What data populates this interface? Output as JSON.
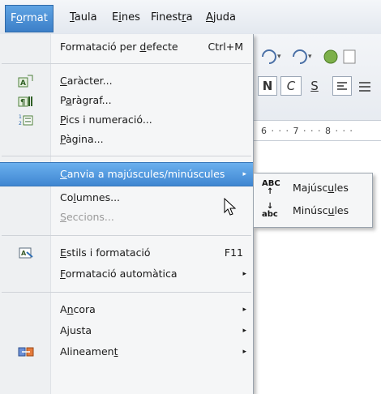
{
  "menubar": {
    "items": [
      {
        "label": "Format",
        "underline": "o",
        "active": true
      },
      {
        "label": "Taula",
        "underline": "T"
      },
      {
        "label": "Eines",
        "underline": "i"
      },
      {
        "label": "Finestra",
        "underline": "r"
      },
      {
        "label": "Ajuda",
        "underline": "A"
      }
    ]
  },
  "format_menu": {
    "default_formatting": {
      "label": "Formatació per defecte",
      "shortcut": "Ctrl+M"
    },
    "character": {
      "label": "Caràcter...",
      "icon": "character-icon"
    },
    "paragraph": {
      "label": "Paràgraf...",
      "icon": "paragraph-icon"
    },
    "bullets": {
      "label": "Pics i numeració...",
      "icon": "bullets-numbering-icon"
    },
    "page": {
      "label": "Pàgina..."
    },
    "change_case": {
      "label": "Canvia a majúscules/minúscules",
      "highlighted": true
    },
    "columns": {
      "label": "Columnes..."
    },
    "sections": {
      "label": "Seccions...",
      "disabled": true
    },
    "styles": {
      "label": "Estils i formatació",
      "shortcut": "F11",
      "icon": "styles-formatting-icon"
    },
    "autocorrect": {
      "label": "Formatació automàtica"
    },
    "anchor": {
      "label": "Àncora"
    },
    "wrap": {
      "label": "Ajusta"
    },
    "alignment": {
      "label": "Alineament",
      "icon": "alignment-icon"
    }
  },
  "change_case_submenu": {
    "uppercase": {
      "label": "Majúscules",
      "glyph_top": "ABC",
      "glyph_bottom": "↑"
    },
    "lowercase": {
      "label": "Minúscules",
      "glyph_top": "↓",
      "glyph_bottom": "abc"
    }
  },
  "toolbar": {
    "bold": "N",
    "italic": "C",
    "underline": "S",
    "ruler_text": "6 · · · 7 · · · 8 · · ·"
  },
  "colors": {
    "highlight": "#3f86d1",
    "menu_bg": "#f5f6f7"
  }
}
